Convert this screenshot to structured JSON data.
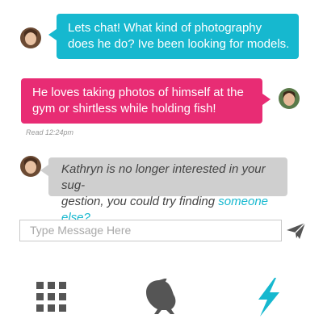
{
  "messages": [
    {
      "text_lines": [
        "Lets chat! What kind of photography",
        "does he do? Ive been looking for models."
      ]
    },
    {
      "text_lines": [
        "He loves taking photos of himself at the",
        "gym or shirtless while holding fish!"
      ]
    },
    {
      "text_part1": "Kathryn is no longer interested in your sug-",
      "text_part2": "gestion, you could try finding ",
      "link_text": "someone else?"
    }
  ],
  "read_receipt": "Read 12:24pm",
  "composer": {
    "placeholder": "Type Message Here"
  },
  "nav": [
    "grid-icon",
    "bird-icon",
    "lightning-icon"
  ],
  "colors": {
    "teal": "#16b8cf",
    "pink": "#e82c74",
    "gray": "#cfcfcf",
    "icon": "#555555"
  }
}
